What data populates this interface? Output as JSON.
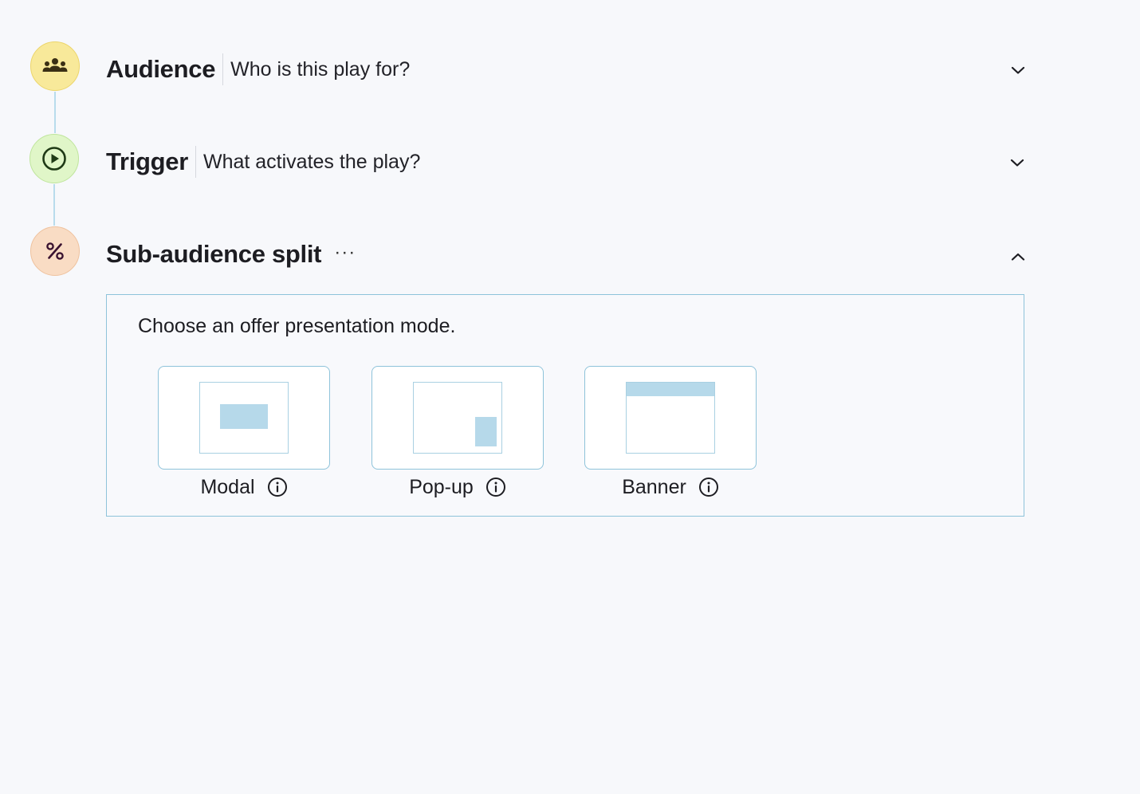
{
  "steps": [
    {
      "title": "Audience",
      "subtitle": "Who is this play for?",
      "icon": "people-icon",
      "expanded": false,
      "color": "#f8e99a"
    },
    {
      "title": "Trigger",
      "subtitle": "What activates the play?",
      "icon": "play-circle-icon",
      "expanded": false,
      "color": "#e0f6c8"
    },
    {
      "title": "Sub-audience split",
      "subtitle": "",
      "icon": "percent-icon",
      "more": "···",
      "expanded": true,
      "color": "#f9dcc4"
    }
  ],
  "panel": {
    "prompt": "Choose an offer presentation mode.",
    "modes": [
      {
        "label": "Modal",
        "icon": "info-icon"
      },
      {
        "label": "Pop-up",
        "icon": "info-icon"
      },
      {
        "label": "Banner",
        "icon": "info-icon"
      }
    ]
  },
  "colors": {
    "accent_border": "#8ec3da",
    "preview_fill": "#b6d9ea",
    "background": "#f7f8fb"
  }
}
